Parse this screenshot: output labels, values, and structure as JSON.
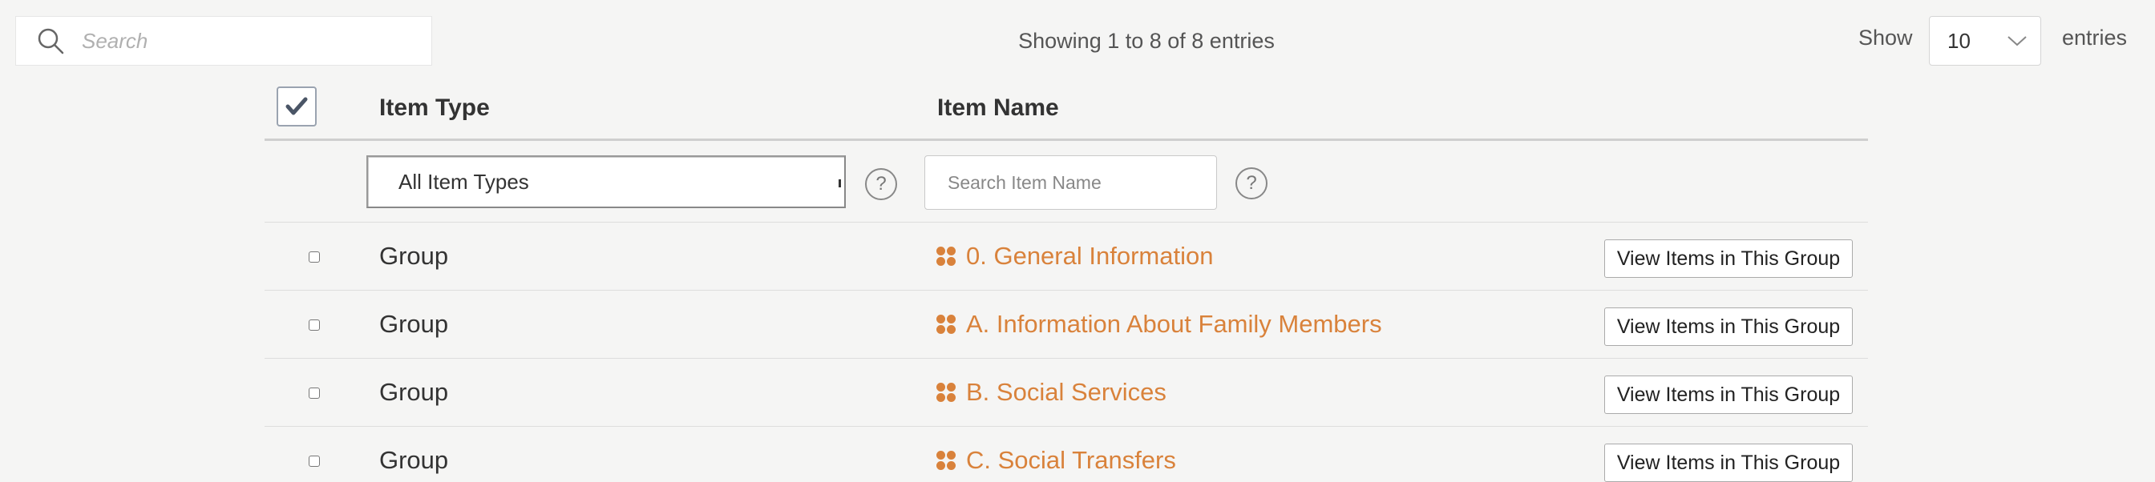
{
  "search": {
    "placeholder": "Search"
  },
  "info": {
    "showing_text": "Showing 1 to 8 of 8 entries"
  },
  "length_control": {
    "show_label": "Show",
    "selected": "10",
    "entries_label": "entries"
  },
  "table": {
    "columns": {
      "item_type": "Item Type",
      "item_name": "Item Name"
    },
    "filters": {
      "item_type_selected": "All Item Types",
      "item_name_placeholder": "Search Item Name",
      "help_glyph": "?"
    },
    "rows": [
      {
        "type": "Group",
        "name": "0. General Information",
        "action": "View Items in This Group"
      },
      {
        "type": "Group",
        "name": "A. Information About Family Members",
        "action": "View Items in This Group"
      },
      {
        "type": "Group",
        "name": "B. Social Services",
        "action": "View Items in This Group"
      },
      {
        "type": "Group",
        "name": "C. Social Transfers",
        "action": "View Items in This Group"
      }
    ]
  },
  "colors": {
    "link": "#d9823b",
    "background": "#f5f5f4"
  },
  "icons": {
    "search": "search-icon",
    "select_all": "checkmark-icon",
    "group": "group-icon",
    "dropdown": "chevron-down-icon"
  }
}
